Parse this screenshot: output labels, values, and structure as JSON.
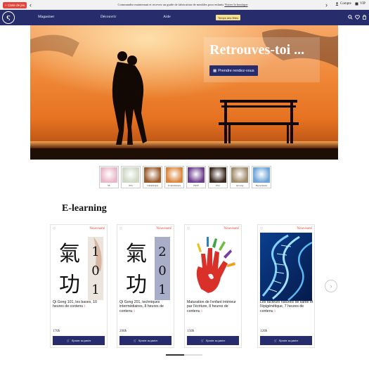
{
  "topbar": {
    "gift_label": "Carte de jeu",
    "announcement": "Commandez maintenant et recevez un guide de fabrication de meubles pour enfants",
    "announcement_link": "Visiter la boutique",
    "account_label": "Compte",
    "vip_label": "VIP"
  },
  "nav": {
    "logo_glyph": "ς",
    "items": [
      {
        "label": "Magasiner"
      },
      {
        "label": "Découvrir"
      },
      {
        "label": "Aide"
      }
    ],
    "badge_label": "Temps des fêtes"
  },
  "hero": {
    "title": "Retrouves-toi ...",
    "button_label": "Prendre rendez-vous"
  },
  "categories": [
    {
      "label": "SE",
      "color": "#e8b7c8"
    },
    {
      "label": "PSS",
      "color": "#cfd8c5"
    },
    {
      "label": "Cimathérapie",
      "color": "#9a5a2c"
    },
    {
      "label": "Trophothérapie",
      "color": "#d9843a"
    },
    {
      "label": "PNSE",
      "color": "#6b3d8c"
    },
    {
      "label": "PSU",
      "color": "#3b2a1f"
    },
    {
      "label": "Qi Gong",
      "color": "#a08a6a"
    },
    {
      "label": "Hypnotiseuse",
      "color": "#6da4d6"
    }
  ],
  "elearning": {
    "title": "E-learning",
    "new_badge": "Nouveauté",
    "add_label": "Ajouter au panier",
    "cards": [
      {
        "title": "Qi Gong 101, les bases, 10 heures de contenu",
        "price": "170$",
        "numbers": [
          "1",
          "0",
          "1"
        ]
      },
      {
        "title": "Qi Gong 201, techniques intermédiaires, 8 heures de contenu",
        "price": "200$",
        "numbers": [
          "2",
          "0",
          "1"
        ]
      },
      {
        "title": "Maturation de l'enfant intérieur par l'écriture, 8 heures de contenu",
        "price": "150$"
      },
      {
        "title": "Les facteurs naturels de santé et l'épigénétique, 7 heures de contenu",
        "price": "120$"
      }
    ],
    "qigong_chars": [
      "氣",
      "功"
    ],
    "info_glyph": "i"
  },
  "slider": {
    "progress": 0.5
  }
}
